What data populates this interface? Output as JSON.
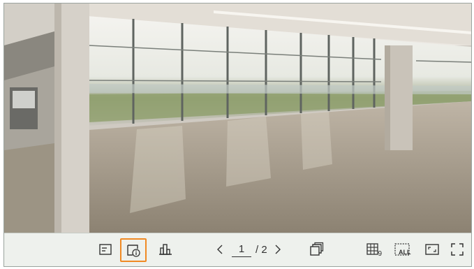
{
  "toolbar": {
    "page_current": "1",
    "page_total": "/ 2",
    "layout_split_label": "9",
    "all_label": "ALL"
  },
  "icons": {
    "event_list": "list-icon",
    "channel_info": "channel-info-icon",
    "statistics": "bar-chart-icon",
    "prev": "chevron-left-icon",
    "next": "chevron-right-icon",
    "multi_page": "stacked-pages-icon",
    "split": "grid-split-icon",
    "all": "all-channels-icon",
    "fit": "aspect-fit-icon",
    "fullscreen": "fullscreen-icon"
  },
  "colors": {
    "highlight": "#f08a24",
    "toolbar_bg": "#eef1ed",
    "icon": "#333333"
  }
}
